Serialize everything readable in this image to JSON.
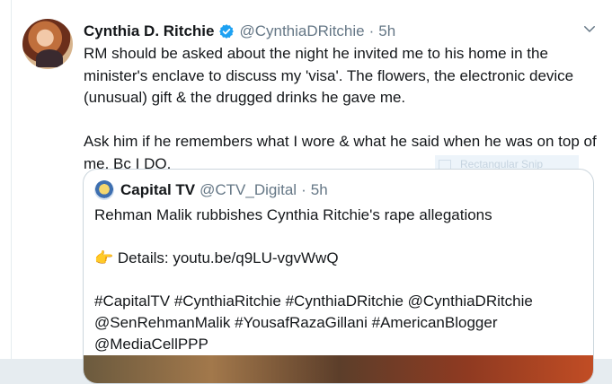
{
  "tweet": {
    "display_name": "Cynthia D. Ritchie",
    "handle": "@CynthiaDRitchie",
    "separator": "·",
    "time": "5h",
    "text": "RM should be asked about the night he invited me to his home in the minister's enclave to discuss my 'visa'. The flowers, the electronic device (unusual) gift & the drugged drinks he gave me.\n\nAsk him if he remembers what I wore & what he said when he was on top of me. Bc I DO."
  },
  "overlay": {
    "snip_label": "Rectangular Snip"
  },
  "quoted_tweet": {
    "display_name": "Capital TV",
    "handle": "@CTV_Digital",
    "separator": "·",
    "time": "5h",
    "headline": "Rehman Malik rubbishes Cynthia Ritchie's rape allegations",
    "details_emoji": "👉",
    "details_text": "Details: youtu.be/q9LU-vgvWwQ",
    "hashtags_line1": "#CapitalTV #CynthiaRitchie #CynthiaDRitchie @CynthiaDRitchie",
    "hashtags_line2": "@SenRehmanMalik #YousafRazaGillani #AmericanBlogger",
    "hashtags_line3": "@MediaCellPPP"
  },
  "colors": {
    "verified": "#1da1f2",
    "muted": "#657786",
    "border": "#ccd6dd"
  }
}
